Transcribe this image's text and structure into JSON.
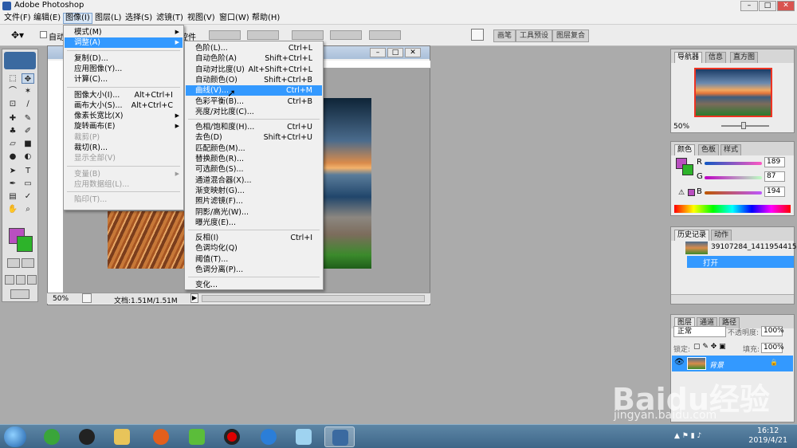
{
  "app": {
    "title": "Adobe Photoshop"
  },
  "window_controls": {
    "minimize": "–",
    "maximize": "□",
    "close": "✕"
  },
  "menubar": [
    "文件(F)",
    "编辑(E)",
    "图像(I)",
    "图层(L)",
    "选择(S)",
    "滤镜(T)",
    "视图(V)",
    "窗口(W)",
    "帮助(H)"
  ],
  "options_bar": {
    "auto_select": "自动",
    "partial": "控件"
  },
  "wells": [
    "画笔",
    "工具预设",
    "图层复合"
  ],
  "image_menu": [
    {
      "label": "模式(M)",
      "submenu": true
    },
    {
      "label": "调整(A)",
      "submenu": true,
      "highlight": true
    },
    {
      "sep": true
    },
    {
      "label": "复制(D)..."
    },
    {
      "label": "应用图像(Y)..."
    },
    {
      "label": "计算(C)..."
    },
    {
      "sep": true
    },
    {
      "label": "图像大小(I)...",
      "shortcut": "Alt+Ctrl+I"
    },
    {
      "label": "画布大小(S)...",
      "shortcut": "Alt+Ctrl+C"
    },
    {
      "label": "像素长宽比(X)",
      "submenu": true
    },
    {
      "label": "旋转画布(E)",
      "submenu": true
    },
    {
      "label": "裁剪(P)",
      "disabled": true
    },
    {
      "label": "裁切(R)..."
    },
    {
      "label": "显示全部(V)",
      "disabled": true
    },
    {
      "sep": true
    },
    {
      "label": "变量(B)",
      "submenu": true,
      "disabled": true
    },
    {
      "label": "应用数据组(L)...",
      "disabled": true
    },
    {
      "sep": true
    },
    {
      "label": "陷印(T)...",
      "disabled": true
    }
  ],
  "adjust_menu": [
    {
      "label": "色阶(L)...",
      "shortcut": "Ctrl+L"
    },
    {
      "label": "自动色阶(A)",
      "shortcut": "Shift+Ctrl+L"
    },
    {
      "label": "自动对比度(U)",
      "shortcut": "Alt+Shift+Ctrl+L"
    },
    {
      "label": "自动颜色(O)",
      "shortcut": "Shift+Ctrl+B"
    },
    {
      "label": "曲线(V)...",
      "shortcut": "Ctrl+M",
      "highlight": true
    },
    {
      "label": "色彩平衡(B)...",
      "shortcut": "Ctrl+B"
    },
    {
      "label": "亮度/对比度(C)..."
    },
    {
      "sep": true
    },
    {
      "label": "色相/饱和度(H)...",
      "shortcut": "Ctrl+U"
    },
    {
      "label": "去色(D)",
      "shortcut": "Shift+Ctrl+U"
    },
    {
      "label": "匹配颜色(M)..."
    },
    {
      "label": "替换颜色(R)..."
    },
    {
      "label": "可选颜色(S)..."
    },
    {
      "label": "通道混合器(X)..."
    },
    {
      "label": "渐变映射(G)..."
    },
    {
      "label": "照片滤镜(F)..."
    },
    {
      "label": "阴影/高光(W)..."
    },
    {
      "label": "曝光度(E)..."
    },
    {
      "sep": true
    },
    {
      "label": "反相(I)",
      "shortcut": "Ctrl+I"
    },
    {
      "label": "色调均化(Q)"
    },
    {
      "label": "阈值(T)..."
    },
    {
      "label": "色调分离(P)..."
    },
    {
      "sep": true
    },
    {
      "label": "变化..."
    }
  ],
  "document": {
    "zoom": "50%",
    "doc_size": "文档:1.51M/1.51M"
  },
  "navigator": {
    "tabs": [
      "导航器",
      "信息",
      "直方图"
    ],
    "zoom": "50%"
  },
  "color_panel": {
    "tabs": [
      "颜色",
      "色板",
      "样式"
    ],
    "channels": [
      {
        "name": "R",
        "value": "189"
      },
      {
        "name": "G",
        "value": "87"
      },
      {
        "name": "B",
        "value": "194"
      }
    ]
  },
  "history_panel": {
    "tabs": [
      "历史记录",
      "动作"
    ],
    "snapshot": "39107284_1411954415...",
    "step": "打开"
  },
  "layers_panel": {
    "tabs": [
      "图层",
      "通道",
      "路径"
    ],
    "blend_mode": "正常",
    "opacity_label": "不透明度:",
    "opacity": "100%",
    "lock_label": "锁定:",
    "fill_label": "填充:",
    "fill": "100%",
    "layer_name": "背景"
  },
  "colors": {
    "accent": "#3399ff",
    "foreground": "#b94fc0",
    "background": "#2db32a"
  },
  "taskbar": {
    "time": "16:12",
    "date": "2019/4/21"
  },
  "watermark": {
    "brand": "Baidu经验",
    "url": "jingyan.baidu.com"
  }
}
